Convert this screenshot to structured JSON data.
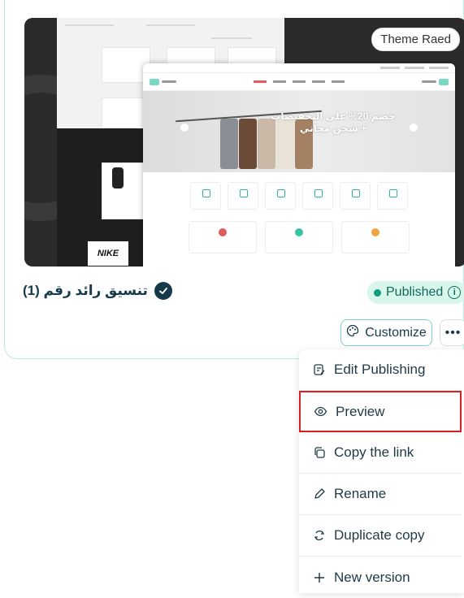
{
  "card": {
    "theme_badge": "Theme Raed",
    "theme_name": "تنسيق رائد رقم (1)",
    "status": "Published",
    "customize_label": "Customize",
    "more_label": "•••"
  },
  "preview_site": {
    "hero_title": "خصم 20% على التخفيضات + شحن مجاني",
    "brand": "NIKE"
  },
  "menu": {
    "items": [
      {
        "label": "Edit Publishing",
        "icon": "edit-publishing-icon"
      },
      {
        "label": "Preview",
        "icon": "eye-icon",
        "highlighted": true
      },
      {
        "label": "Copy the link",
        "icon": "copy-link-icon"
      },
      {
        "label": "Rename",
        "icon": "pencil-icon"
      },
      {
        "label": "Duplicate copy",
        "icon": "duplicate-icon"
      },
      {
        "label": "New version",
        "icon": "plus-icon"
      }
    ]
  },
  "colors": {
    "accent": "#7ad7c6",
    "published_bg": "#d9f6ec",
    "published_text": "#0e6b55",
    "highlight_border": "#d9201f",
    "dark_text": "#163a4a"
  }
}
